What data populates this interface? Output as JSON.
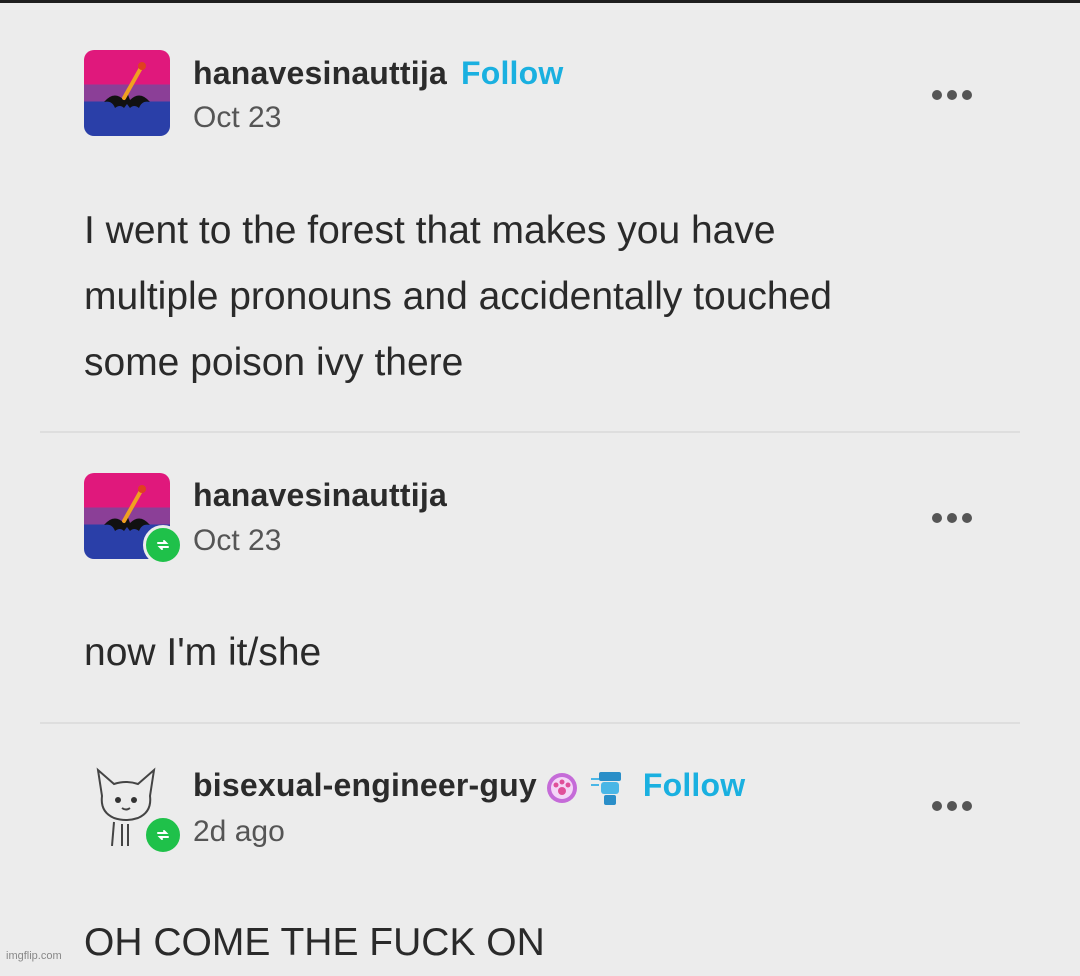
{
  "posts": [
    {
      "username": "hanavesinauttija",
      "follow_label": "Follow",
      "date": "Oct 23",
      "text_lines": [
        "I went to the forest that makes you have",
        "multiple pronouns and accidentally touched",
        "some poison ivy there"
      ],
      "avatar": "bisexual-flag-bat-avatar",
      "more_icon": "ellipsis-icon"
    },
    {
      "username": "hanavesinauttija",
      "date": "Oct 23",
      "text": "now I'm it/she",
      "avatar": "bisexual-flag-bat-avatar",
      "badge_icon": "reblog-icon",
      "more_icon": "ellipsis-icon"
    },
    {
      "username": "bisexual-engineer-guy",
      "follow_label": "Follow",
      "date": "2d ago",
      "text": "OH COME THE FUCK ON",
      "avatar": "cat-sketch-avatar",
      "badge_icon": "reblog-icon",
      "user_badges": [
        "paw-badge-icon",
        "robot-badge-icon"
      ],
      "more_icon": "ellipsis-icon"
    }
  ],
  "watermark": "imgflip.com",
  "colors": {
    "background": "#ececec",
    "follow": "#1ab0e0",
    "reblog_badge": "#1fc14a",
    "flag_pink": "#e0187c",
    "flag_purple": "#8b3f97",
    "flag_blue": "#2a3fa8"
  }
}
